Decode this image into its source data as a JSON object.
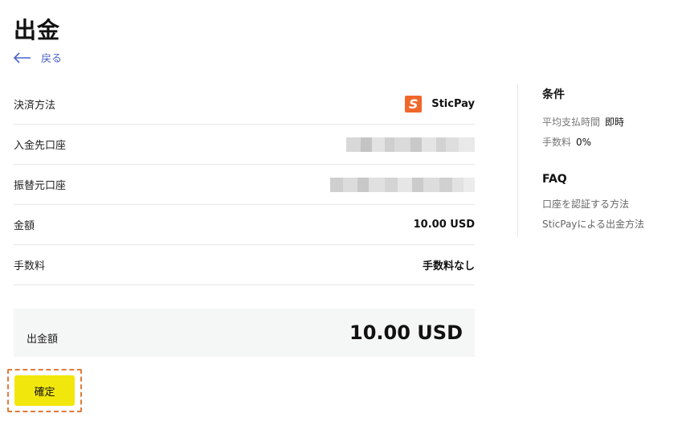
{
  "page": {
    "title": "出金",
    "back_label": "戻る"
  },
  "form": {
    "method_label": "決済方法",
    "method_name": "SticPay",
    "method_logo_letter": "S",
    "deposit_account_label": "入金先口座",
    "source_account_label": "振替元口座",
    "amount_label": "金額",
    "amount_value": "10.00 USD",
    "fee_label": "手数料",
    "fee_value": "手数料なし"
  },
  "total": {
    "label": "出金額",
    "value": "10.00 USD"
  },
  "confirm_label": "確定",
  "side": {
    "conditions_title": "条件",
    "avg_time_label": "平均支払時間",
    "avg_time_value": "即時",
    "fee_label": "手数料",
    "fee_value": "0%",
    "faq_title": "FAQ",
    "faq_links": [
      "口座を認証する方法",
      "SticPayによる出金方法"
    ]
  },
  "colors": {
    "accent_link": "#4a62c9",
    "confirm_button": "#f2e70c",
    "highlight_border": "#e07b39",
    "sticpay_brand": "#f0672a"
  }
}
